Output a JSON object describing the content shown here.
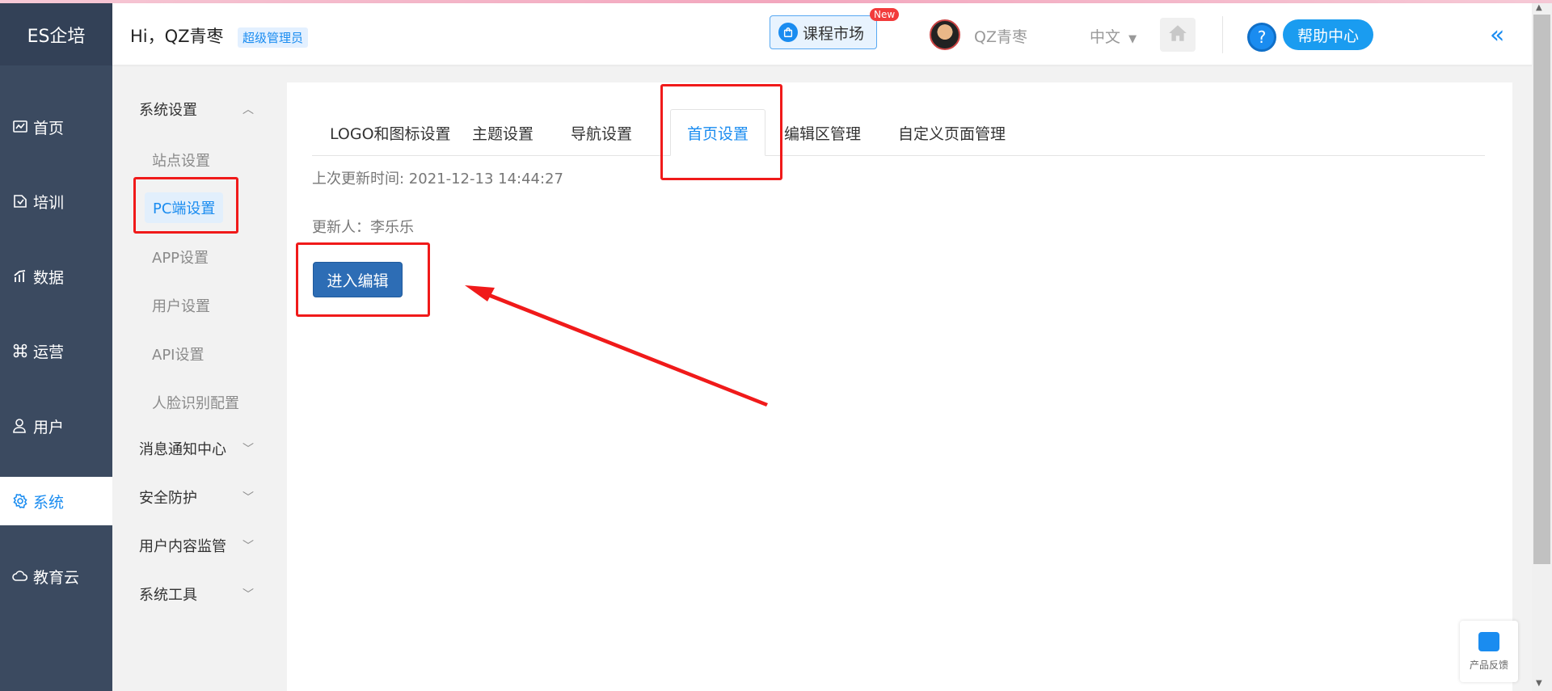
{
  "brand": "ES企培",
  "nav": [
    {
      "label": "首页",
      "icon": "chart-icon"
    },
    {
      "label": "培训",
      "icon": "book-icon"
    },
    {
      "label": "数据",
      "icon": "bars-icon"
    },
    {
      "label": "运营",
      "icon": "command-icon"
    },
    {
      "label": "用户",
      "icon": "user-icon"
    },
    {
      "label": "系统",
      "icon": "gear-icon"
    },
    {
      "label": "教育云",
      "icon": "cloud-icon"
    }
  ],
  "submenu": {
    "groups": [
      "系统设置",
      "消息通知中心",
      "安全防护",
      "用户内容监管",
      "系统工具"
    ],
    "links": [
      "站点设置",
      "PC端设置",
      "APP设置",
      "用户设置",
      "API设置",
      "人脸识别配置"
    ]
  },
  "topbar": {
    "greeting": "Hi，QZ青枣",
    "role": "超级管理员",
    "market": "课程市场",
    "new_badge": "New",
    "username": "QZ青枣",
    "language": "中文",
    "help": "帮助中心"
  },
  "tabs": [
    "LOGO和图标设置",
    "主题设置",
    "导航设置",
    "首页设置",
    "编辑区管理",
    "自定义页面管理"
  ],
  "info": {
    "updated_time": "上次更新时间:  2021-12-13 14:44:27",
    "updater": "更新人：李乐乐"
  },
  "edit_button": "进入编辑",
  "feedback": "产品反馈",
  "colors": {
    "accent": "#1a8cf0",
    "nav_bg": "#3b4a60",
    "annotation": "#f01a1a",
    "primary_button": "#2d6db5"
  }
}
